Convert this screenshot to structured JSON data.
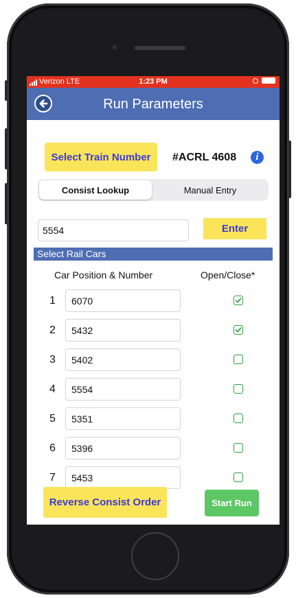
{
  "status": {
    "carrier": "Verizon",
    "network": "LTE",
    "time": "1:23 PM"
  },
  "nav": {
    "title": "Run Parameters"
  },
  "train": {
    "select_label": "Select Train Number",
    "number": "#ACRL 4608"
  },
  "tabs": [
    {
      "label": "Consist Lookup",
      "selected": true
    },
    {
      "label": "Manual Entry",
      "selected": false
    }
  ],
  "lookup": {
    "value": "5554",
    "enter_label": "Enter"
  },
  "section": {
    "title": "Select Rail Cars"
  },
  "columns": {
    "position": "Car Position & Number",
    "open_close": "Open/Close*"
  },
  "cars": [
    {
      "position": "1",
      "number": "6070",
      "checked": true
    },
    {
      "position": "2",
      "number": "5432",
      "checked": true
    },
    {
      "position": "3",
      "number": "5402",
      "checked": false
    },
    {
      "position": "4",
      "number": "5554",
      "checked": false
    },
    {
      "position": "5",
      "number": "5351",
      "checked": false
    },
    {
      "position": "6",
      "number": "5396",
      "checked": false
    },
    {
      "position": "7",
      "number": "5453",
      "checked": false
    }
  ],
  "actions": {
    "reverse_label": "Reverse Consist Order",
    "start_label": "Start Run"
  },
  "colors": {
    "nav_blue": "#4e6db3",
    "status_red": "#e3321f",
    "button_yellow": "#fae45a",
    "button_text": "#3c3ad6",
    "start_green": "#5dc763",
    "check_green": "#2e9e3a"
  },
  "icons": {
    "back": "arrow-left-circle-icon",
    "info": "info-icon",
    "check": "checkmark-icon"
  }
}
